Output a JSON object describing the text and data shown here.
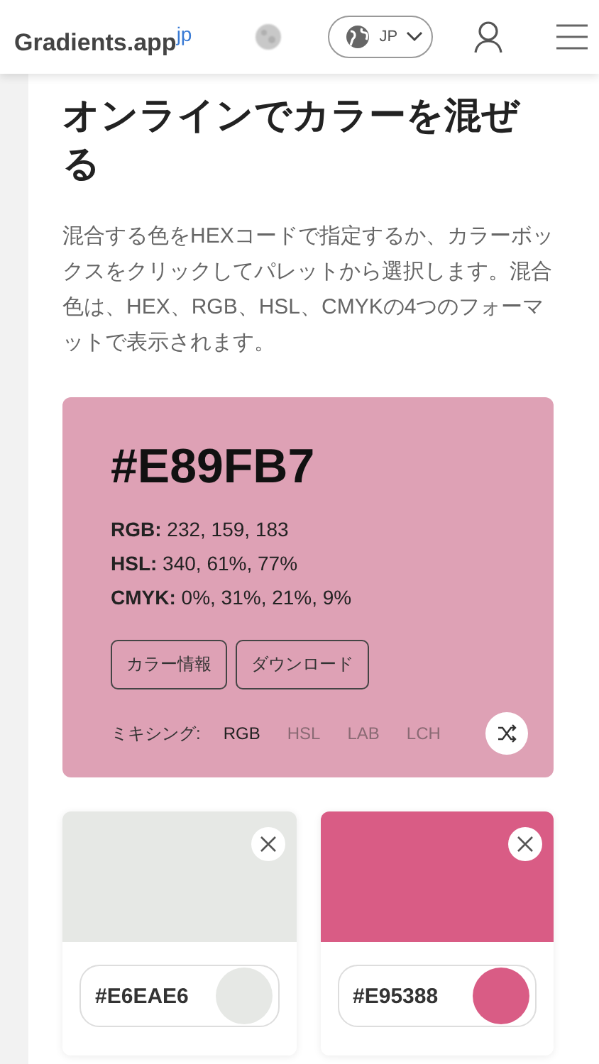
{
  "header": {
    "logo": "Gradients.app",
    "logo_suffix": "jp",
    "language": "JP"
  },
  "title": "オンラインでカラーを混ぜる",
  "description": "混合する色をHEXコードで指定するか、カラーボックスをクリックしてパレットから選択します。混合色は、HEX、RGB、HSL、CMYKの4つのフォーマットで表示されます。",
  "result": {
    "hex": "#E89FB7",
    "color": "#dea1b5",
    "values": [
      {
        "label": "RGB:",
        "value": " 232, 159, 183"
      },
      {
        "label": "HSL:",
        "value": " 340, 61%, 77%"
      },
      {
        "label": "CMYK:",
        "value": " 0%, 31%, 21%, 9%"
      }
    ],
    "buttons": [
      "カラー情報",
      "ダウンロード"
    ],
    "mixing_label": "ミキシング:",
    "modes": [
      {
        "label": "RGB",
        "selected": true
      },
      {
        "label": "HSL",
        "selected": false
      },
      {
        "label": "LAB",
        "selected": false
      },
      {
        "label": "LCH",
        "selected": false
      }
    ]
  },
  "swatches": [
    {
      "hex": "#E6EAE6",
      "color": "#e6e8e5"
    },
    {
      "hex": "#E95388",
      "color": "#d95c85"
    }
  ]
}
